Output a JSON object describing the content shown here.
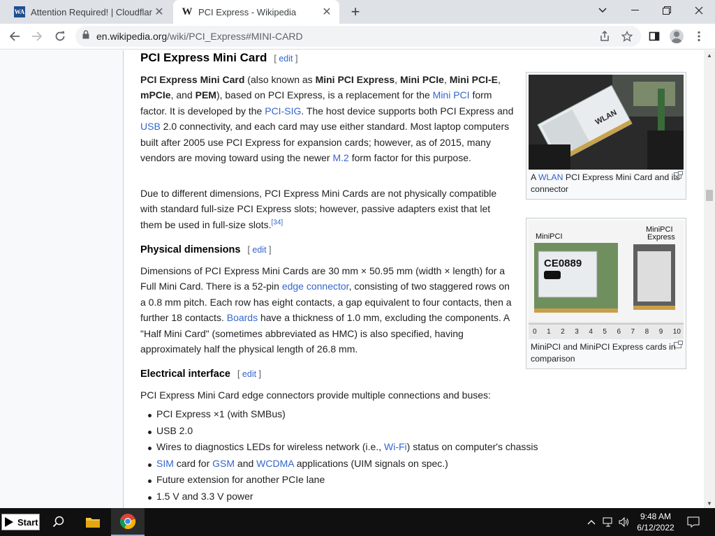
{
  "browser": {
    "tabs": [
      {
        "title": "Attention Required! | Cloudflare",
        "icon": "wa-favicon",
        "active": false
      },
      {
        "title": "PCI Express - Wikipedia",
        "icon": "wikipedia-favicon",
        "active": true
      }
    ],
    "favicon_text": {
      "wa": "WA",
      "wiki": "W"
    },
    "url_host": "en.wikipedia.org",
    "url_path": "/wiki/PCI_Express#MINI-CARD"
  },
  "article": {
    "section_title": "PCI Express Mini Card",
    "edit_label": "edit",
    "p1": {
      "b1": "PCI Express Mini Card",
      "t1": " (also known as ",
      "b2": "Mini PCI Express",
      "t2": ", ",
      "b3": "Mini PCIe",
      "t3": ", ",
      "b4": "Mini PCI-E",
      "t4": ", ",
      "b5": "mPCIe",
      "t5": ", and ",
      "b6": "PEM",
      "t6": "), based on PCI Express, is a replacement for the ",
      "l1": "Mini PCI",
      "t7": " form factor. It is developed by the ",
      "l2": "PCI-SIG",
      "t8": ". The host device supports both PCI Express and ",
      "l3": "USB",
      "t9": " 2.0 connectivity, and each card may use either standard. Most laptop computers built after 2005 use PCI Express for expansion cards; however, as of 2015, many vendors are moving toward using the newer ",
      "l4": "M.2",
      "t10": " form factor for this purpose."
    },
    "p2": {
      "text": "Due to different dimensions, PCI Express Mini Cards are not physically compatible with standard full-size PCI Express slots; however, passive adapters exist that let them be used in full-size slots.",
      "ref": "[34]"
    },
    "sub1": "Physical dimensions",
    "p3": {
      "t1": "Dimensions of PCI Express Mini Cards are 30 mm × 50.95 mm (width × length) for a Full Mini Card. There is a 52-pin ",
      "l1": "edge connector",
      "t2": ", consisting of two staggered rows on a 0.8 mm pitch. Each row has eight contacts, a gap equivalent to four contacts, then a further 18 contacts. ",
      "l2": "Boards",
      "t3": " have a thickness of 1.0 mm, excluding the components. A \"Half Mini Card\" (sometimes abbreviated as HMC) is also specified, having approximately half the physical length of 26.8 mm."
    },
    "sub2": "Electrical interface",
    "p4": "PCI Express Mini Card edge connectors provide multiple connections and buses:",
    "list": {
      "i1": "PCI Express ×1 (with SMBus)",
      "i2": "USB 2.0",
      "i3a": "Wires to diagnostics LEDs for wireless network (i.e., ",
      "i3l": "Wi-Fi",
      "i3b": ") status on computer's chassis",
      "i4l1": "SIM",
      "i4a": " card for ",
      "i4l2": "GSM",
      "i4b": " and ",
      "i4l3": "WCDMA",
      "i4c": " applications (UIM signals on spec.)",
      "i5": "Future extension for another PCIe lane",
      "i6": "1.5 V and 3.3 V power"
    },
    "figure1": {
      "cap_a": "A ",
      "cap_link": "WLAN",
      "cap_b": " PCI Express Mini Card and its connector",
      "image_text": "WLAN"
    },
    "figure2": {
      "caption": "MiniPCI and MiniPCI Express cards in comparison",
      "label_left": "MiniPCI",
      "label_right_1": "MiniPCI",
      "label_right_2": "Express",
      "ruler": [
        "0",
        "1",
        "2",
        "3",
        "4",
        "5",
        "6",
        "7",
        "8",
        "9",
        "10"
      ]
    }
  },
  "taskbar": {
    "start_label": "Start",
    "time": "9:48 AM",
    "date": "6/12/2022"
  },
  "colors": {
    "link": "#3366cc",
    "taskbar": "#101010",
    "tabstrip": "#dee1e6"
  }
}
